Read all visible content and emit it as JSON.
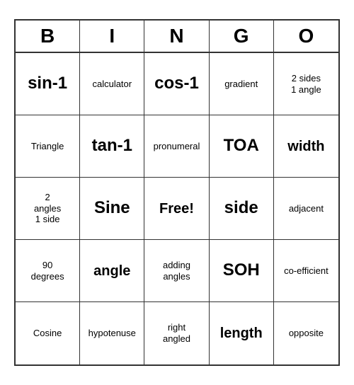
{
  "header": {
    "letters": [
      "B",
      "I",
      "N",
      "G",
      "O"
    ]
  },
  "cells": [
    {
      "text": "sin-1",
      "size": "large"
    },
    {
      "text": "calculator",
      "size": "small"
    },
    {
      "text": "cos-1",
      "size": "large"
    },
    {
      "text": "gradient",
      "size": "small"
    },
    {
      "text": "2 sides\n1 angle",
      "size": "small"
    },
    {
      "text": "Triangle",
      "size": "small"
    },
    {
      "text": "tan-1",
      "size": "large"
    },
    {
      "text": "pronumeral",
      "size": "small"
    },
    {
      "text": "TOA",
      "size": "large"
    },
    {
      "text": "width",
      "size": "medium"
    },
    {
      "text": "2\nangles\n1 side",
      "size": "small"
    },
    {
      "text": "Sine",
      "size": "large"
    },
    {
      "text": "Free!",
      "size": "medium"
    },
    {
      "text": "side",
      "size": "large"
    },
    {
      "text": "adjacent",
      "size": "small"
    },
    {
      "text": "90\ndegrees",
      "size": "small"
    },
    {
      "text": "angle",
      "size": "medium"
    },
    {
      "text": "adding\nangles",
      "size": "small"
    },
    {
      "text": "SOH",
      "size": "large"
    },
    {
      "text": "co-efficient",
      "size": "small"
    },
    {
      "text": "Cosine",
      "size": "small"
    },
    {
      "text": "hypotenuse",
      "size": "small"
    },
    {
      "text": "right\nangled",
      "size": "small"
    },
    {
      "text": "length",
      "size": "medium"
    },
    {
      "text": "opposite",
      "size": "small"
    }
  ]
}
